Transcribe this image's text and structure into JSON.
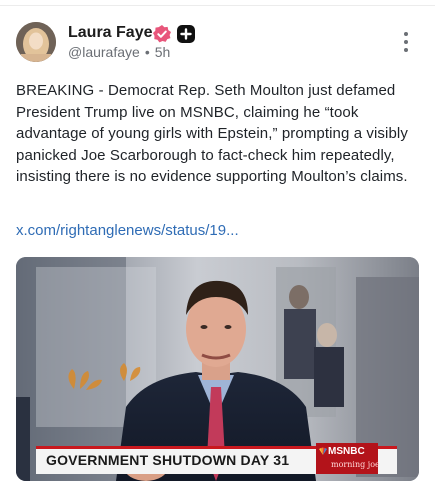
{
  "author": {
    "name": "Laura Faye",
    "handle": "@laurafaye",
    "separator": "•",
    "time": "5h"
  },
  "post": {
    "text": "BREAKING - Democrat Rep. Seth Moulton just defamed President Trump live on MSNBC, claiming he “took advantage of young girls with Epstein,” prompting a visibly panicked Joe Scarborough to fact-check him repeatedly, insisting there is no evidence supporting Moulton’s claims.",
    "link": "x.com/rightanglenews/status/19..."
  },
  "media": {
    "banner_text": "GOVERNMENT SHUTDOWN DAY 31",
    "brand": "MSNBC",
    "show": "morning joe"
  },
  "icons": {
    "verified": "verified-badge-icon",
    "plus": "plus-badge-icon",
    "more": "more-vertical-icon"
  },
  "colors": {
    "link": "#2f6cb5",
    "verified": "#e8567b",
    "banner_accent": "#c9181e",
    "brand_red": "#b3131a"
  }
}
